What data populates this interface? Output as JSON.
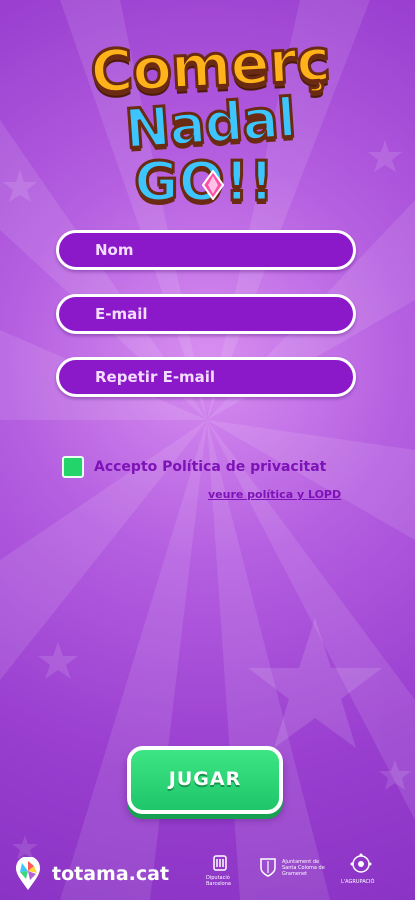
{
  "logo": {
    "line1": "Comerç",
    "line2": "Nadal",
    "line3": "GO!!"
  },
  "form": {
    "name_placeholder": "Nom",
    "email_placeholder": "E-mail",
    "repeat_email_placeholder": "Repetir E-mail"
  },
  "consent": {
    "label": "Accepto Política de privacitat",
    "policy_link": "veure política y LOPD",
    "checked": true
  },
  "actions": {
    "play_label": "JUGAR"
  },
  "footer": {
    "brand": "totama.cat",
    "sponsor1": "Diputació Barcelona",
    "sponsor2": "Ajuntament de Santa Coloma de Gramenet",
    "sponsor3": "L'AGRUPACIÓ"
  },
  "colors": {
    "background": "#a24ad6",
    "field_bg": "#8b18c9",
    "button": "#2ad874",
    "checkbox": "#23d46a"
  }
}
